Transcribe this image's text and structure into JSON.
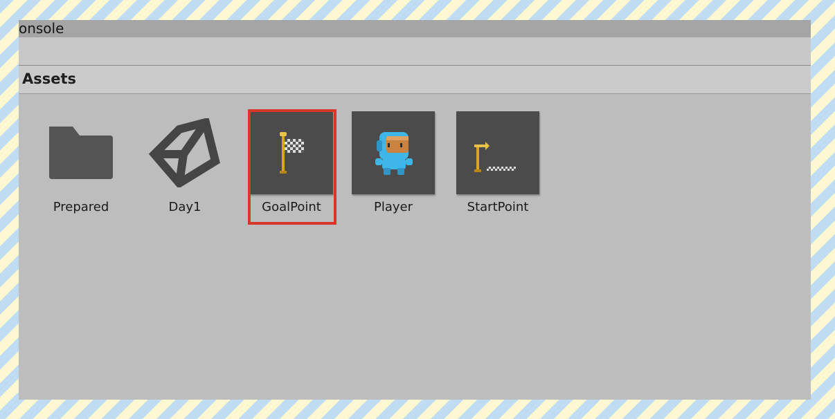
{
  "window": {
    "tab_title": "Console"
  },
  "breadcrumb": {
    "label": "Assets"
  },
  "assets": [
    {
      "label": "Prepared",
      "icon": "folder-icon",
      "selected": false
    },
    {
      "label": "Day1",
      "icon": "unity-scene-icon",
      "selected": false
    },
    {
      "label": "GoalPoint",
      "icon": "goal-flag-icon",
      "selected": true
    },
    {
      "label": "Player",
      "icon": "player-sprite-icon",
      "selected": false
    },
    {
      "label": "StartPoint",
      "icon": "start-point-icon",
      "selected": false
    }
  ],
  "colors": {
    "selection_outline": "#d7372b",
    "thumbnail_bg": "#4b4b4b",
    "panel_bg": "#bdbdbd"
  }
}
